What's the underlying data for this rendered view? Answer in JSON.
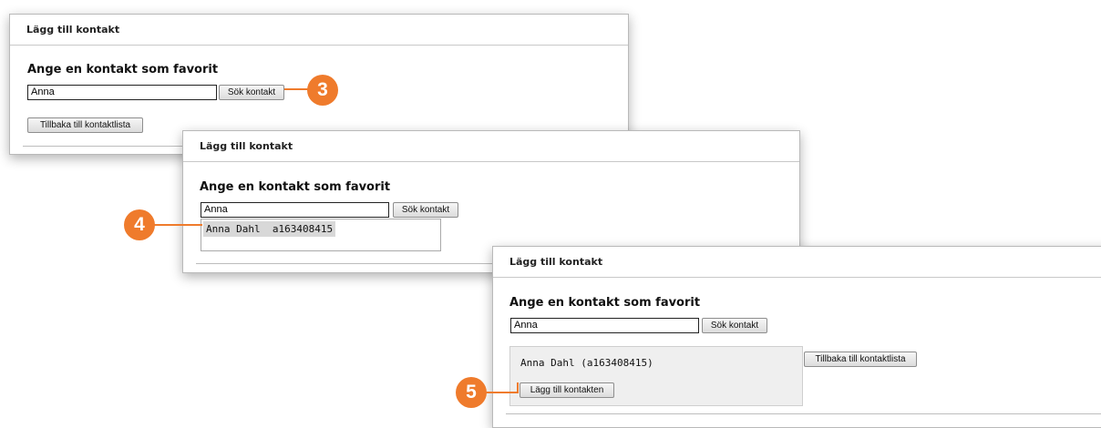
{
  "panels": [
    {
      "title": "Lägg till kontakt",
      "heading": "Ange en kontakt som favorit",
      "search_value": "Anna",
      "search_button": "Sök kontakt",
      "back_button": "Tillbaka till kontaktlista"
    },
    {
      "title": "Lägg till kontakt",
      "heading": "Ange en kontakt som favorit",
      "search_value": "Anna",
      "search_button": "Sök kontakt",
      "suggestion": "Anna Dahl  a163408415"
    },
    {
      "title": "Lägg till kontakt",
      "heading": "Ange en kontakt som favorit",
      "search_value": "Anna",
      "search_button": "Sök kontakt",
      "result_name": "Anna Dahl (a163408415)",
      "add_button": "Lägg till kontakten",
      "back_button": "Tillbaka till kontaktlista"
    }
  ],
  "callouts": [
    "3",
    "4",
    "5"
  ],
  "colors": {
    "accent": "#ef7b2c"
  }
}
